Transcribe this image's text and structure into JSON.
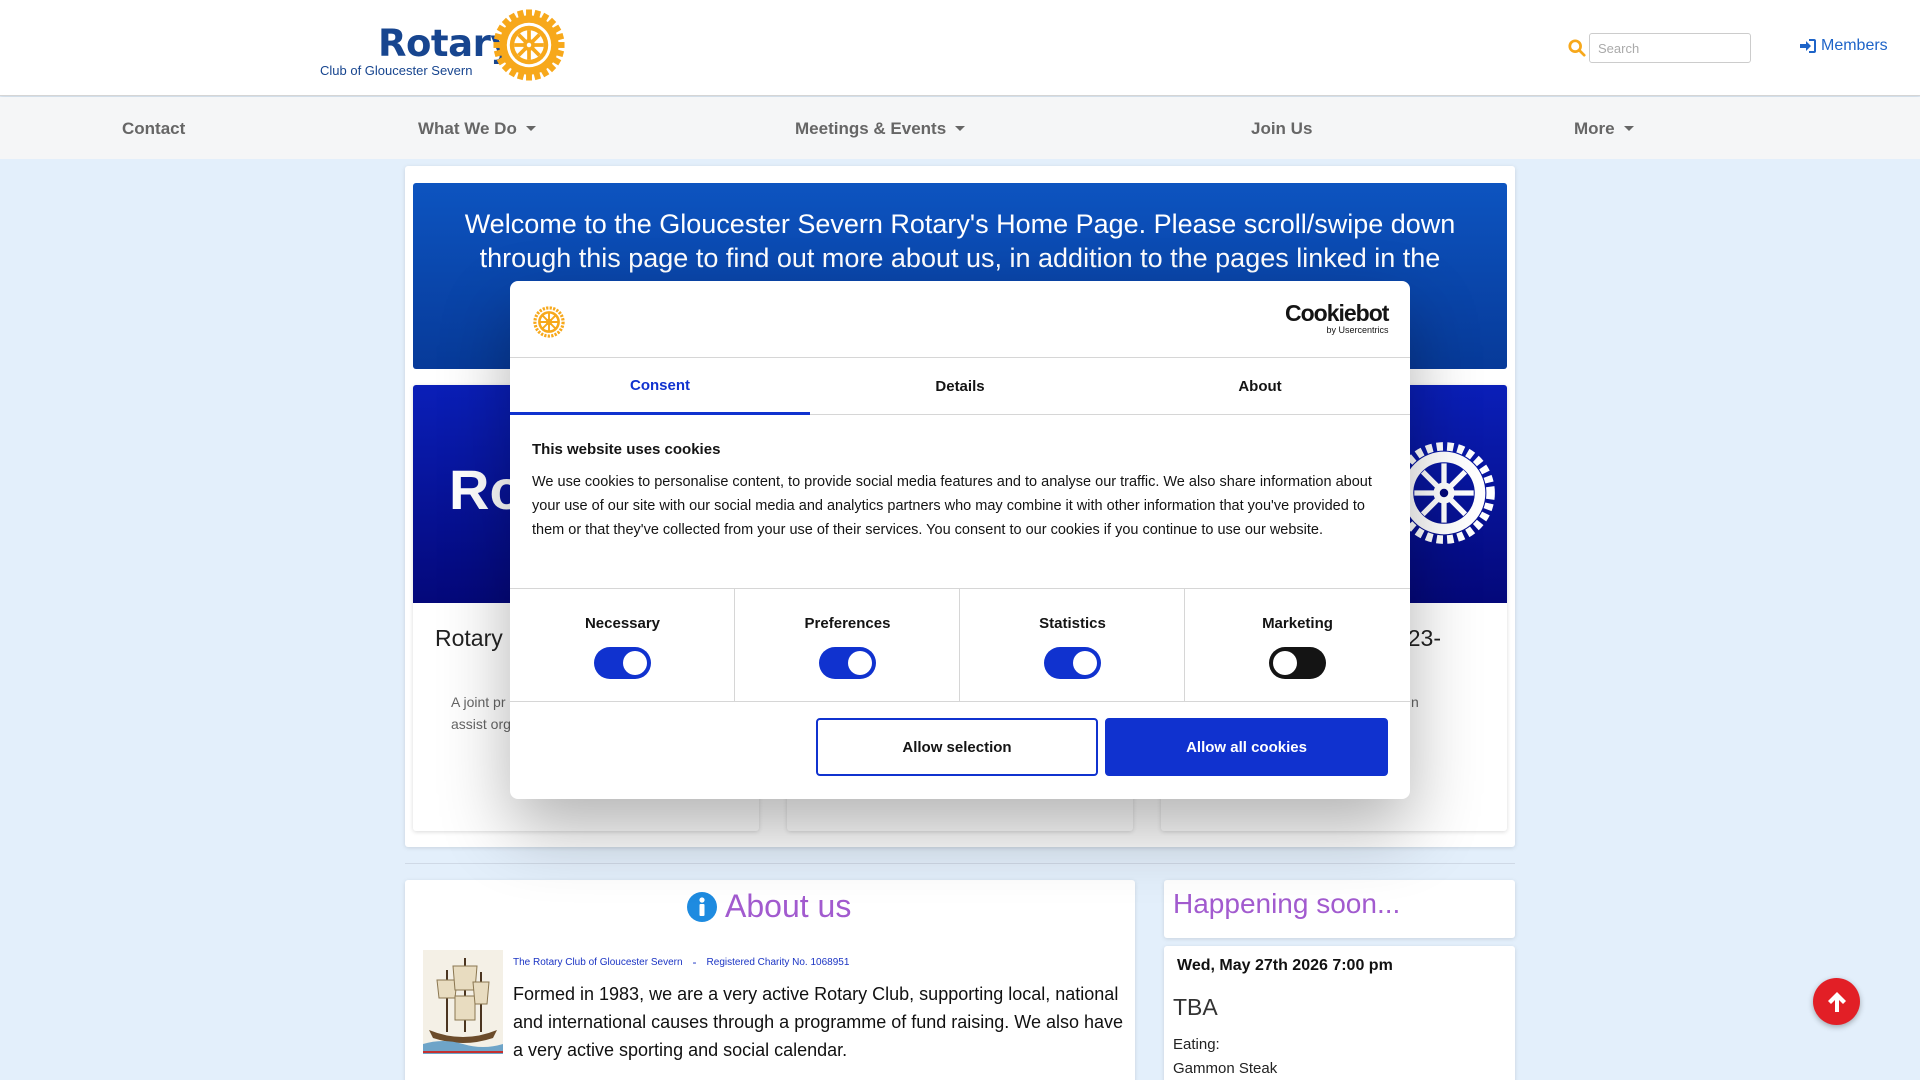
{
  "header": {
    "logo_word": "Rotary",
    "logo_sub": "Club of Gloucester Severn",
    "search_placeholder": "Search",
    "members_label": "Members"
  },
  "nav": {
    "items": [
      {
        "label": "Contact",
        "dropdown": false
      },
      {
        "label": "What We Do",
        "dropdown": true
      },
      {
        "label": "Meetings & Events",
        "dropdown": true
      },
      {
        "label": "Join Us",
        "dropdown": false
      },
      {
        "label": "More",
        "dropdown": true
      }
    ]
  },
  "banner": {
    "text": "Welcome to the Gloucester Severn Rotary's Home Page. Please scroll/swipe down through this page to find out more about us, in addition to the pages linked in the menu bar left."
  },
  "tiles": [
    {
      "image_text": "Ro",
      "title": "Rotary",
      "desc_line1": "A joint pr",
      "desc_line2": "assist org"
    },
    {
      "image_text": "",
      "title": "",
      "desc_line1": "",
      "desc_line2": ""
    },
    {
      "image_text": "",
      "title": "e 2023-",
      "desc_line1": "n",
      "desc_line2": ""
    }
  ],
  "about": {
    "title": "About us",
    "club_name": "The Rotary Club of Gloucester Severn",
    "separator": "-",
    "charity": "Registered Charity No. 1068951",
    "text": "Formed in 1983, we are a very active Rotary Club, supporting local, national and international causes through a programme of fund raising. We also have a very active sporting and social calendar."
  },
  "happening": {
    "title": "Happening soon...",
    "event": {
      "date": "Wed, May 27th 2026 7:00 pm",
      "title": "TBA",
      "eating_label": "Eating:",
      "eating_value": "Gammon Steak"
    }
  },
  "cookie": {
    "brand_name": "Cookiebot",
    "brand_sub": "by Usercentrics",
    "tabs": [
      {
        "label": "Consent",
        "active": true
      },
      {
        "label": "Details",
        "active": false
      },
      {
        "label": "About",
        "active": false
      }
    ],
    "title": "This website uses cookies",
    "body": "We use cookies to personalise content, to provide social media features and to analyse our traffic. We also share information about your use of our site with our social media and analytics partners who may combine it with other information that you've provided to them or that they've collected from your use of their services. You consent to our cookies if you continue to use our website.",
    "categories": [
      {
        "label": "Necessary",
        "enabled": true
      },
      {
        "label": "Preferences",
        "enabled": true
      },
      {
        "label": "Statistics",
        "enabled": true
      },
      {
        "label": "Marketing",
        "enabled": false
      }
    ],
    "allow_selection": "Allow selection",
    "allow_all": "Allow all cookies"
  },
  "colors": {
    "rotary_blue": "#17458f",
    "rotary_gold": "#f7a81b",
    "cookie_accent": "#1032cf",
    "heading_purple": "#a25bcf",
    "scroll_button": "#e21f26"
  },
  "icons": [
    "rotary-wheel-icon",
    "search-icon",
    "sign-in-icon",
    "info-circle-icon",
    "arrow-up-icon"
  ]
}
